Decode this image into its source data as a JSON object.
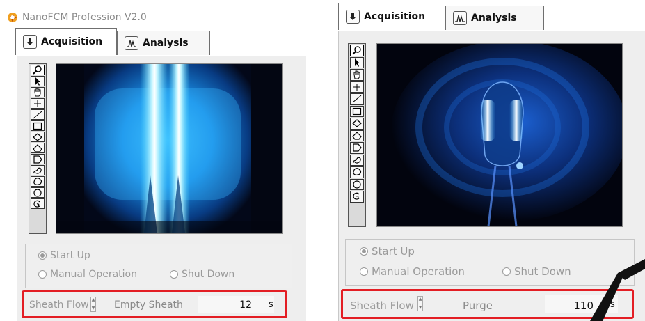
{
  "app": {
    "title": "NanoFCM Profession  V2.0"
  },
  "tabs": [
    {
      "label": "Acquisition",
      "icon": "download-arrow-icon"
    },
    {
      "label": "Analysis",
      "icon": "waveform-icon"
    }
  ],
  "toolbar": {
    "tools": [
      "zoom-icon",
      "arrow-pointer-icon",
      "hand-pan-icon",
      "crosshair-icon",
      "line-icon",
      "rectangle-icon",
      "diamond-icon",
      "polygon-icon",
      "pentagon-flag-icon",
      "freehand-icon",
      "blob-icon",
      "ellipse-icon",
      "lasso-icon"
    ]
  },
  "modes": {
    "start_up": "Start Up",
    "manual_operation": "Manual Operation",
    "shut_down": "Shut Down",
    "selected": "Start Up"
  },
  "left_panel": {
    "sheath_flow_label": "Sheath Flow",
    "sheath_mode": "Empty Sheath",
    "value": "12",
    "unit": "s"
  },
  "right_panel": {
    "sheath_flow_label": "Sheath Flow",
    "sheath_mode": "Purge",
    "value": "110",
    "unit": "s"
  },
  "colors": {
    "highlight_box": "#e31e24",
    "camera_glow": "#1e9bff",
    "disabled_text": "#9a9a9a"
  }
}
